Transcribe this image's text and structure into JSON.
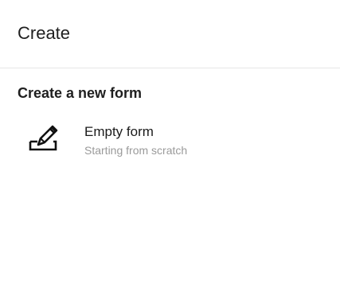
{
  "header": {
    "title": "Create"
  },
  "section": {
    "title": "Create a new form",
    "options": [
      {
        "title": "Empty form",
        "subtitle": "Starting from scratch",
        "icon": "pencil-form-icon"
      }
    ]
  }
}
